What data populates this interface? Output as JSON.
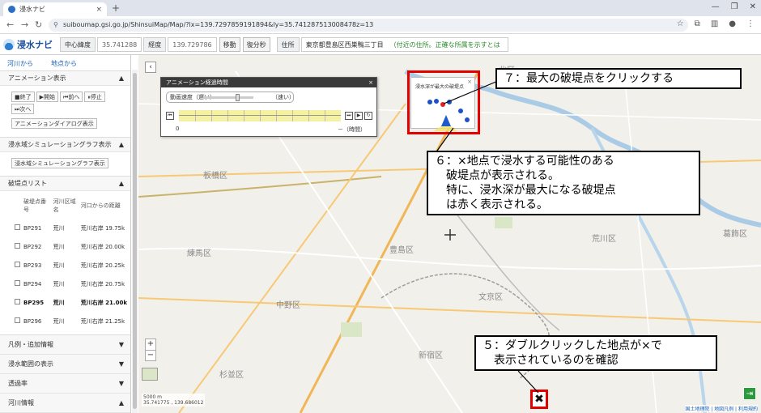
{
  "browser": {
    "tab_title": "浸水ナビ",
    "tab_close": "×",
    "new_tab": "+",
    "url": "suiboumap.gsi.go.jp/ShinsuiMap/Map/?lx=139.7297859191894&ly=35.741287513008478z=13",
    "window_controls": [
      "—",
      "❐",
      "✕"
    ]
  },
  "header": {
    "logo": "浸水ナビ",
    "center_lat_label": "中心緯度",
    "center_lat_value": "35.741288",
    "center_lon_label": "経度",
    "center_lon_value": "139.729786",
    "move_button": "移動",
    "restore_button": "復分秒",
    "address_label": "住所",
    "address_value": "東京都豊島区西巣鴨三丁目",
    "address_note": "（付近の住所。正確な所属を示すとは限らない。）"
  },
  "sidebar": {
    "tabs": [
      "河川から",
      "地点から"
    ],
    "animation": {
      "title": "アニメーション表示",
      "buttons": [
        "■終了",
        "▶開始",
        "⏮前へ",
        "⏸停止",
        "⏭次へ"
      ],
      "dialog_button": "アニメーションダイアログ表示"
    },
    "graph": {
      "title": "浸水域シミュレーショングラフ表示",
      "button": "浸水域シミュレーショングラフ表示"
    },
    "breach": {
      "title": "破堤点リスト",
      "columns": [
        "破堤点番号",
        "河川区域名",
        "河口からの距離"
      ],
      "rows": [
        {
          "id": "BP291",
          "river": "荒川",
          "dist": "荒川右岸 19.75k"
        },
        {
          "id": "BP292",
          "river": "荒川",
          "dist": "荒川右岸 20.00k"
        },
        {
          "id": "BP293",
          "river": "荒川",
          "dist": "荒川右岸 20.25k"
        },
        {
          "id": "BP294",
          "river": "荒川",
          "dist": "荒川右岸 20.75k"
        },
        {
          "id": "BP295",
          "river": "荒川",
          "dist": "荒川右岸 21.00k"
        },
        {
          "id": "BP296",
          "river": "荒川",
          "dist": "荒川右岸 21.25k"
        },
        {
          "id": "BP297",
          "river": "荒川",
          "dist": "荒川右岸 21.50k"
        }
      ],
      "highlighted_index": 4
    },
    "collapsed_sections": [
      "凡例・追加情報",
      "浸水範囲の表示",
      "透過率",
      "河川情報"
    ]
  },
  "animation_panel": {
    "title": "アニメーション経過時間",
    "close": "×",
    "speed_label": "動画速度（遅い）",
    "speed_fast": "（速い）",
    "time_start": "0",
    "time_unit": "－（時間）"
  },
  "popup": {
    "title": "浸水深が最大の破堤点",
    "close": "×"
  },
  "map": {
    "ward_labels": [
      "北区",
      "板橋区",
      "練馬区",
      "豊島区",
      "文京区",
      "中野区",
      "新宿区",
      "杉並区",
      "荒川区",
      "葛飾区"
    ],
    "zoom_in": "+",
    "zoom_out": "−",
    "scale": "5000 m",
    "coords": "35.741775 , 139.686012",
    "attribution": "国土地理院 | 地図凡例 | 利用規約",
    "marker_symbol": "✖"
  },
  "annotations": {
    "step7": "７：最大の破堤点をクリックする",
    "step6": "６：×地点で浸水する可能性のある\n　破堤点が表示される。\n　特に、浸水深が最大になる破堤点\n　は赤く表示される。",
    "step5": "５：ダブルクリックした地点が×で\n　表示されているのを確認"
  },
  "colors": {
    "highlight": "#e50000",
    "brand": "#1a4e9a",
    "timeline": "#f4f1a0"
  }
}
